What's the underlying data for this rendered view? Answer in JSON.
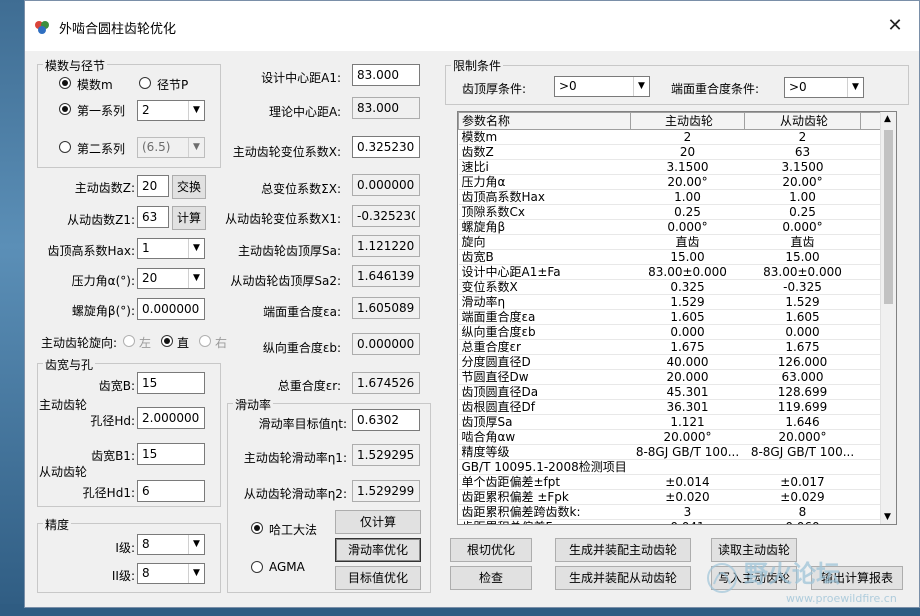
{
  "window": {
    "title": "外啮合圆柱齿轮优化"
  },
  "module_group": {
    "title": "模数与径节",
    "radio_module": "模数m",
    "radio_pitch": "径节P",
    "radio_series1": "第一系列",
    "series1_value": "2",
    "radio_series2": "第二系列",
    "series2_value": "(6.5)"
  },
  "gear_inputs": {
    "z_label": "主动齿数Z:",
    "z_value": "20",
    "swap_button": "交换",
    "z1_label": "从动齿数Z1:",
    "z1_value": "63",
    "calc_button": "计算",
    "hax_label": "齿顶高系数Hax:",
    "hax_value": "1",
    "alpha_label": "压力角α(°):",
    "alpha_value": "20",
    "beta_label": "螺旋角β(°):",
    "beta_value": "0.000000",
    "hand_label": "主动齿轮旋向:",
    "hand_left": "左",
    "hand_straight": "直",
    "hand_right": "右"
  },
  "width_group": {
    "title": "齿宽与孔",
    "driving_label": "主动齿轮",
    "b_label": "齿宽B:",
    "b_value": "15",
    "hd_label": "孔径Hd:",
    "hd_value": "2.000000",
    "driven_label": "从动齿轮",
    "b1_label": "齿宽B1:",
    "b1_value": "15",
    "hd1_label": "孔径Hd1:",
    "hd1_value": "6"
  },
  "precision_group": {
    "title": "精度",
    "i_label": "I级:",
    "i_value": "8",
    "ii_label": "II级:",
    "ii_value": "8"
  },
  "center": {
    "a1_label": "设计中心距A1:",
    "a1_value": "83.000",
    "a_label": "理论中心距A:",
    "a_value": "83.000",
    "x_label": "主动齿轮变位系数X:",
    "x_value": "0.325230",
    "sx_label": "总变位系数ΣX:",
    "sx_value": "0.000000",
    "x1_label": "从动齿轮变位系数X1:",
    "x1_value": "-0.325230",
    "sa_label": "主动齿轮齿顶厚Sa:",
    "sa_value": "1.121220",
    "sa2_label": "从动齿轮齿顶厚Sa2:",
    "sa2_value": "1.646139",
    "ea_label": "端面重合度εa:",
    "ea_value": "1.605089",
    "eb_label": "纵向重合度εb:",
    "eb_value": "0.000000",
    "er_label": "总重合度εr:",
    "er_value": "1.674526"
  },
  "slip_group": {
    "title": "滑动率",
    "target_label": "滑动率目标值ηt:",
    "target_value": "0.6302",
    "n1_label": "主动齿轮滑动率η1:",
    "n1_value": "1.529295",
    "n2_label": "从动齿轮滑动率η2:",
    "n2_value": "1.529299",
    "radio_harbin": "哈工大法",
    "radio_agma": "AGMA",
    "btn_calc_only": "仅计算",
    "btn_slip_opt": "滑动率优化",
    "btn_target_opt": "目标值优化"
  },
  "limits_group": {
    "title": "限制条件",
    "tip_label": "齿顶厚条件:",
    "tip_value": ">0",
    "overlap_label": "端面重合度条件:",
    "overlap_value": ">0"
  },
  "table": {
    "headers": [
      "参数名称",
      "主动齿轮",
      "从动齿轮"
    ],
    "rows": [
      [
        "模数m",
        "2",
        "2"
      ],
      [
        "齿数Z",
        "20",
        "63"
      ],
      [
        "速比i",
        "3.1500",
        "3.1500"
      ],
      [
        "压力角α",
        "20.00°",
        "20.00°"
      ],
      [
        "齿顶高系数Hax",
        "1.00",
        "1.00"
      ],
      [
        "顶隙系数Cx",
        "0.25",
        "0.25"
      ],
      [
        "螺旋角β",
        "0.000°",
        "0.000°"
      ],
      [
        "旋向",
        "直齿",
        "直齿"
      ],
      [
        "齿宽B",
        "15.00",
        "15.00"
      ],
      [
        "设计中心距A1±Fa",
        "83.00±0.000",
        "83.00±0.000"
      ],
      [
        "变位系数X",
        "0.325",
        "-0.325"
      ],
      [
        "滑动率η",
        "1.529",
        "1.529"
      ],
      [
        "端面重合度εa",
        "1.605",
        "1.605"
      ],
      [
        "纵向重合度εb",
        "0.000",
        "0.000"
      ],
      [
        "总重合度εr",
        "1.675",
        "1.675"
      ],
      [
        "分度圆直径D",
        "40.000",
        "126.000"
      ],
      [
        "节圆直径Dw",
        "20.000",
        "63.000"
      ],
      [
        "齿顶圆直径Da",
        "45.301",
        "128.699"
      ],
      [
        "齿根圆直径Df",
        "36.301",
        "119.699"
      ],
      [
        "齿顶厚Sa",
        "1.121",
        "1.646"
      ],
      [
        "啮合角αw",
        "20.000°",
        "20.000°"
      ],
      [
        "精度等级",
        "8-8GJ GB/T 100...",
        "8-8GJ GB/T 100..."
      ],
      [
        "GB/T 10095.1-2008检测项目",
        "",
        ""
      ],
      [
        "单个齿距偏差±fpt",
        "±0.014",
        "±0.017"
      ],
      [
        "齿距累积偏差 ±Fpk",
        "±0.020",
        "±0.029"
      ],
      [
        "齿距累积偏差跨齿数k:",
        "3",
        "8"
      ],
      [
        "齿距累积总偏差Fp",
        "0.041",
        "0.060"
      ]
    ]
  },
  "actions": {
    "undercut_opt": "根切优化",
    "gen_driving": "生成并装配主动齿轮",
    "read_driving": "读取主动齿轮",
    "check": "检查",
    "gen_driven": "生成并装配从动齿轮",
    "write_driving": "写入主动齿轮",
    "export_report": "输出计算报表"
  },
  "watermark": {
    "text_cn": "野火论坛",
    "text_url": "www.proewildfire.cn"
  },
  "colors": {
    "window_bg": "#f0f0f0",
    "desktop": "#4a7fa8"
  }
}
